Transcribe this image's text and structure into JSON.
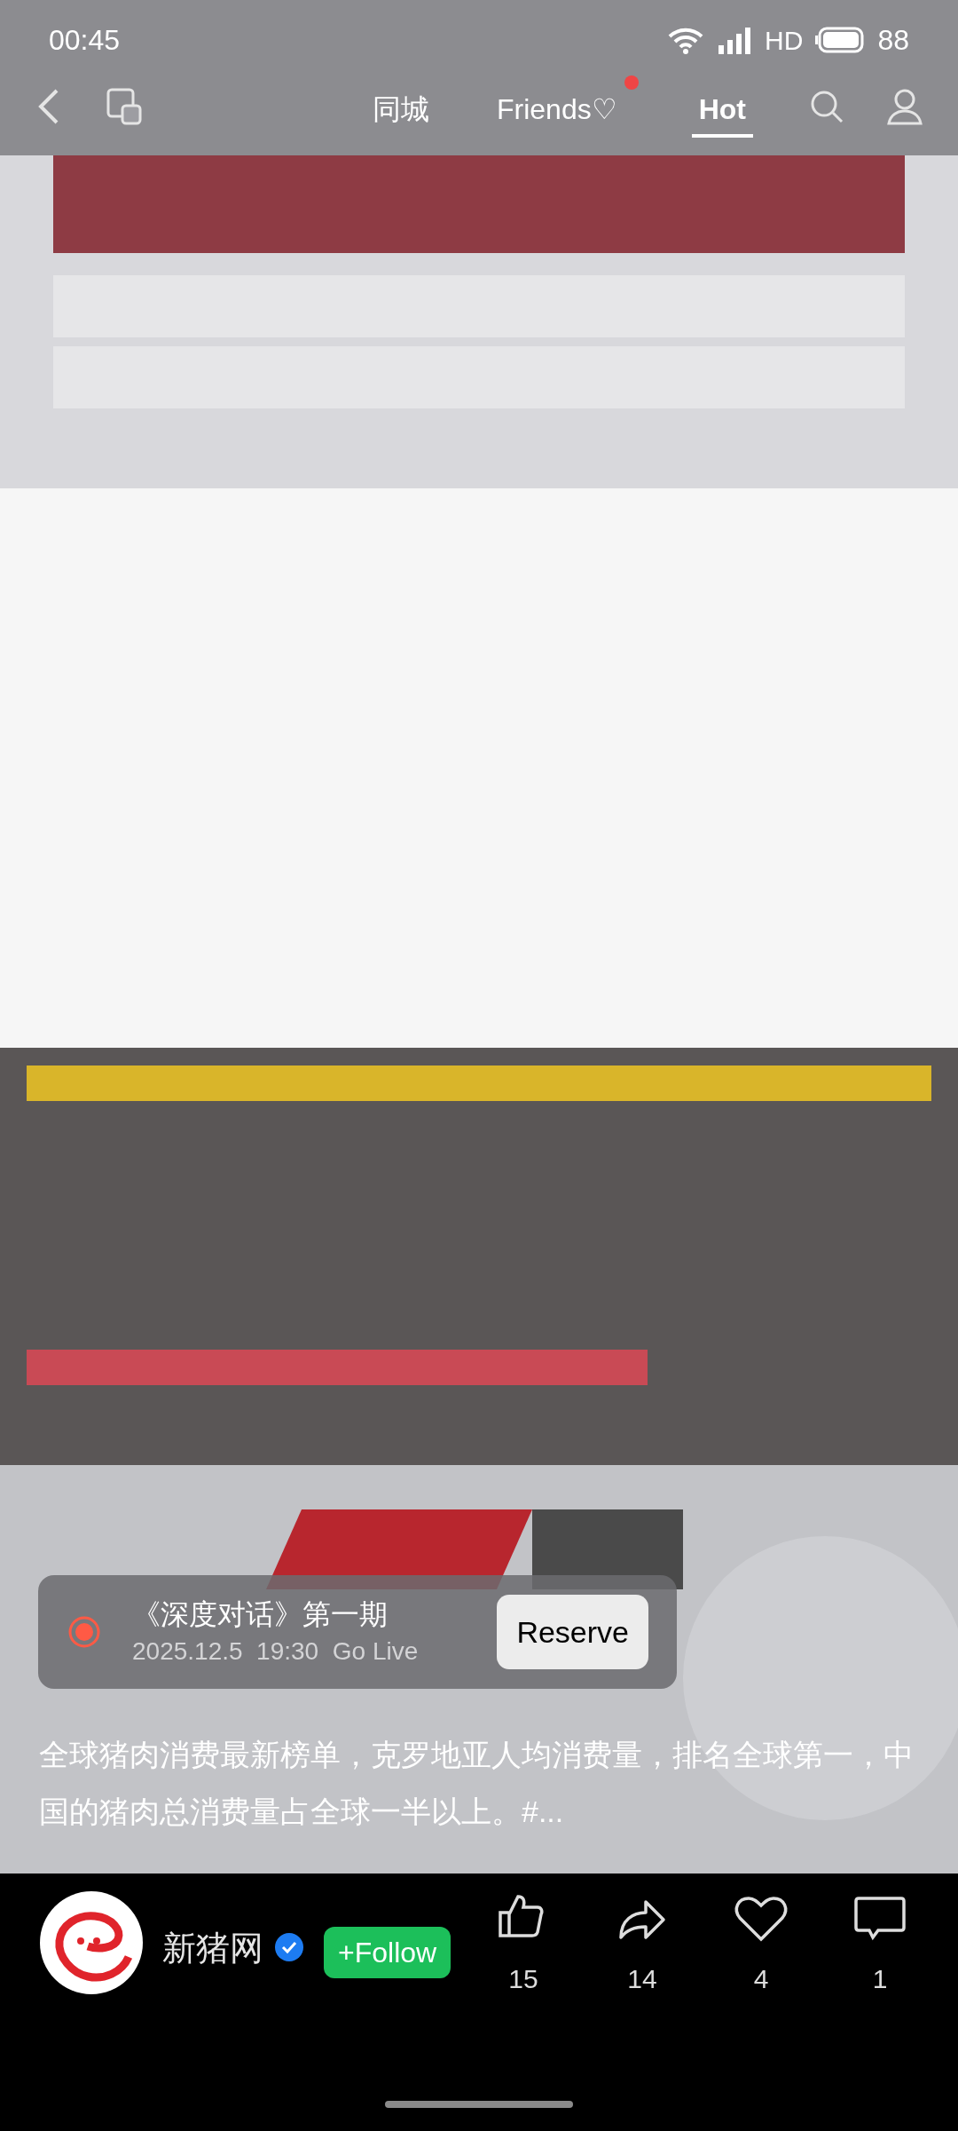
{
  "status_bar": {
    "time": "00:45",
    "network": "HD",
    "battery": "88"
  },
  "top_nav": {
    "tabs": [
      {
        "label": "同城",
        "selected": false,
        "dot": false
      },
      {
        "label": "Friends♡",
        "selected": false,
        "dot": true
      },
      {
        "label": "Hot",
        "selected": true,
        "dot": false
      }
    ]
  },
  "live_card": {
    "title": "《深度对话》第一期",
    "subtitle": "2025.12.5  19:30  Go Live",
    "button": "Reserve"
  },
  "description": "全球猪肉消费最新榜单，克罗地亚人均消费量，排名全球第一，中国的猪肉总消费量占全球一半以上。#...",
  "author": {
    "name": "新猪网",
    "verified": true,
    "follow_label": "+Follow"
  },
  "actions": [
    {
      "kind": "like",
      "count": "15"
    },
    {
      "kind": "share",
      "count": "14"
    },
    {
      "kind": "favorite",
      "count": "4"
    },
    {
      "kind": "comment",
      "count": "1"
    }
  ]
}
